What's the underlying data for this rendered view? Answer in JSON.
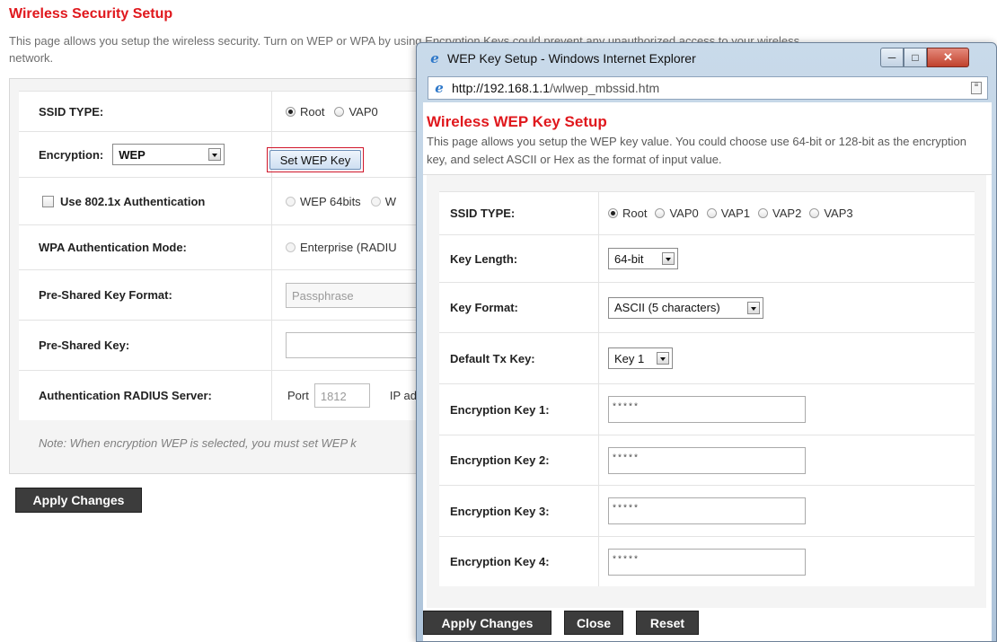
{
  "main": {
    "title": "Wireless Security Setup",
    "description": "This page allows you setup the wireless security. Turn on WEP or WPA by using Encryption Keys could prevent any unauthorized access to your wireless network.",
    "ssid_type": {
      "label": "SSID TYPE:",
      "options": [
        "Root",
        "VAP0"
      ],
      "selected": "Root"
    },
    "encryption": {
      "label": "Encryption:",
      "value": "WEP",
      "set_key_button": "Set WEP Key"
    },
    "use_8021x": {
      "label": "Use 802.1x Authentication",
      "checked": false,
      "options": [
        "WEP 64bits",
        "W"
      ]
    },
    "wpa_auth_mode": {
      "label": "WPA Authentication Mode:",
      "options": [
        "Enterprise (RADIU"
      ]
    },
    "psk_format": {
      "label": "Pre-Shared Key Format:",
      "value": "Passphrase"
    },
    "psk": {
      "label": "Pre-Shared Key:",
      "value": ""
    },
    "radius": {
      "label": "Authentication RADIUS Server:",
      "port_label": "Port",
      "port_value": "1812",
      "ip_label": "IP ad"
    },
    "note": "Note: When encryption WEP is selected, you must set WEP k",
    "apply_button": "Apply Changes"
  },
  "popup": {
    "window_title": "WEP Key Setup - Windows Internet Explorer",
    "address_host": "http://192.168.1.1",
    "address_path": "/wlwep_mbssid.htm",
    "title": "Wireless WEP Key Setup",
    "description": "This page allows you setup the WEP key value. You could choose use 64-bit or 128-bit as the encryption key, and select ASCII or Hex as the format of input value.",
    "ssid_type": {
      "label": "SSID TYPE:",
      "options": [
        "Root",
        "VAP0",
        "VAP1",
        "VAP2",
        "VAP3"
      ],
      "selected": "Root"
    },
    "key_length": {
      "label": "Key Length:",
      "value": "64-bit"
    },
    "key_format": {
      "label": "Key Format:",
      "value": "ASCII (5 characters)"
    },
    "default_tx_key": {
      "label": "Default Tx Key:",
      "value": "Key 1"
    },
    "keys": [
      {
        "label": "Encryption Key 1:",
        "value": "*****"
      },
      {
        "label": "Encryption Key 2:",
        "value": "*****"
      },
      {
        "label": "Encryption Key 3:",
        "value": "*****"
      },
      {
        "label": "Encryption Key 4:",
        "value": "*****"
      }
    ],
    "buttons": {
      "apply": "Apply Changes",
      "close": "Close",
      "reset": "Reset"
    }
  }
}
